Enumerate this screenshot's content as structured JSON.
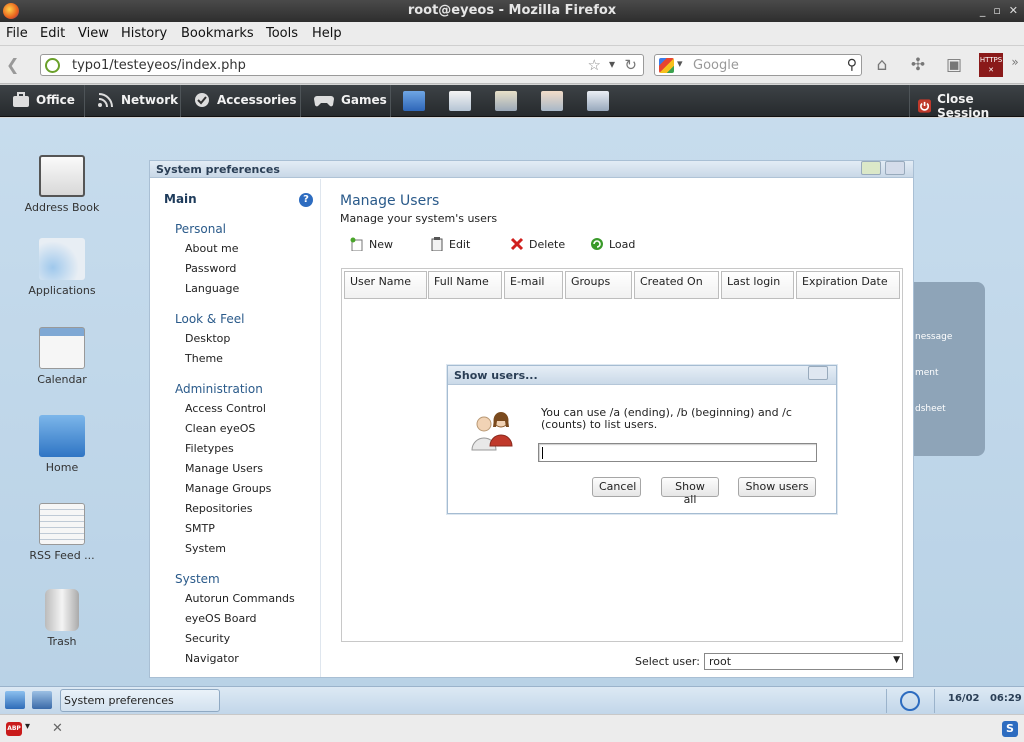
{
  "window": {
    "title": "root@eyeos - Mozilla Firefox"
  },
  "menubar": {
    "items": [
      "File",
      "Edit",
      "View",
      "History",
      "Bookmarks",
      "Tools",
      "Help"
    ]
  },
  "navbar": {
    "url": "typo1/testeyeos/index.php",
    "search_placeholder": "Google",
    "https_label": "HTTPS"
  },
  "eyeos_bar": {
    "menus": [
      "Office",
      "Network",
      "Accessories",
      "Games"
    ],
    "close_session": "Close Session"
  },
  "desktop_icons": [
    {
      "label": "Address Book",
      "icon": "address-book-icon"
    },
    {
      "label": "Applications",
      "icon": "applications-icon"
    },
    {
      "label": "Calendar",
      "icon": "calendar-icon"
    },
    {
      "label": "Home",
      "icon": "home-folder-icon"
    },
    {
      "label": "RSS Feed ...",
      "icon": "rss-feed-icon"
    },
    {
      "label": "Trash",
      "icon": "trash-icon"
    }
  ],
  "bg_window_texts": [
    "nessage",
    "ment",
    "dsheet"
  ],
  "pref_window": {
    "title": "System preferences",
    "sidebar": {
      "main": "Main",
      "personal": "Personal",
      "personal_items": [
        "About me",
        "Password",
        "Language"
      ],
      "look": "Look & Feel",
      "look_items": [
        "Desktop",
        "Theme"
      ],
      "admin": "Administration",
      "admin_items": [
        "Access Control",
        "Clean eyeOS",
        "Filetypes",
        "Manage Users",
        "Manage Groups",
        "Repositories",
        "SMTP",
        "System"
      ],
      "system": "System",
      "system_items": [
        "Autorun Commands",
        "eyeOS Board",
        "Security",
        "Navigator"
      ]
    },
    "manage_users": {
      "title": "Manage Users",
      "subtitle": "Manage your system's users",
      "toolbar": [
        "New",
        "Edit",
        "Delete",
        "Load"
      ],
      "columns": [
        "User Name",
        "Full Name",
        "E-mail",
        "Groups",
        "Created On",
        "Last login",
        "Expiration Date"
      ],
      "select_user_label": "Select user:",
      "select_user_value": "root"
    }
  },
  "dialog": {
    "title": "Show users...",
    "message": "You can use /a (ending), /b (beginning) and /c (counts) to list users.",
    "input_value": "",
    "buttons": {
      "cancel": "Cancel",
      "show_all": "Show all",
      "show_users": "Show users"
    }
  },
  "taskbar": {
    "task": "System preferences",
    "date": "16/02",
    "time": "06:29"
  }
}
